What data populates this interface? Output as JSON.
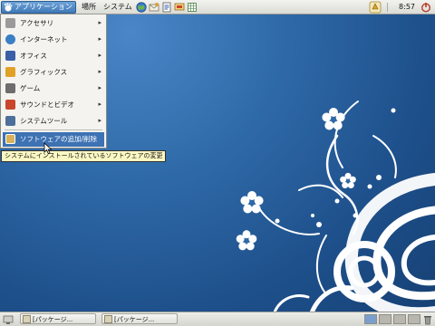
{
  "top_panel": {
    "applications_label": "アプリケーション",
    "places_label": "場所",
    "system_label": "システム",
    "clock": "8:57"
  },
  "apps_menu": {
    "items": [
      {
        "label": "アクセサリ",
        "icon": "accessories-icon",
        "color": "#8f8f8f"
      },
      {
        "label": "インターネット",
        "icon": "internet-globe-icon",
        "color": "#3a7fc4"
      },
      {
        "label": "オフィス",
        "icon": "office-icon",
        "color": "#3a5fa8"
      },
      {
        "label": "グラフィックス",
        "icon": "graphics-icon",
        "color": "#e0a126"
      },
      {
        "label": "ゲーム",
        "icon": "games-icon",
        "color": "#6d6d6d"
      },
      {
        "label": "サウンドとビデオ",
        "icon": "sound-video-icon",
        "color": "#c9462c"
      },
      {
        "label": "システムツール",
        "icon": "system-tools-icon",
        "color": "#4e6f9b"
      }
    ],
    "add_remove_label": "ソフトウェアの追加/削除"
  },
  "tooltip": "システムにインストールされているソフトウェアの変更",
  "taskbar": {
    "tasks": [
      "[パッケージ...",
      "[パッケージ..."
    ]
  },
  "colors": {
    "menu_highlight": "#3d72b3",
    "desktop_blue": "#2f6aa8",
    "tooltip_bg": "#fbf8c3"
  }
}
